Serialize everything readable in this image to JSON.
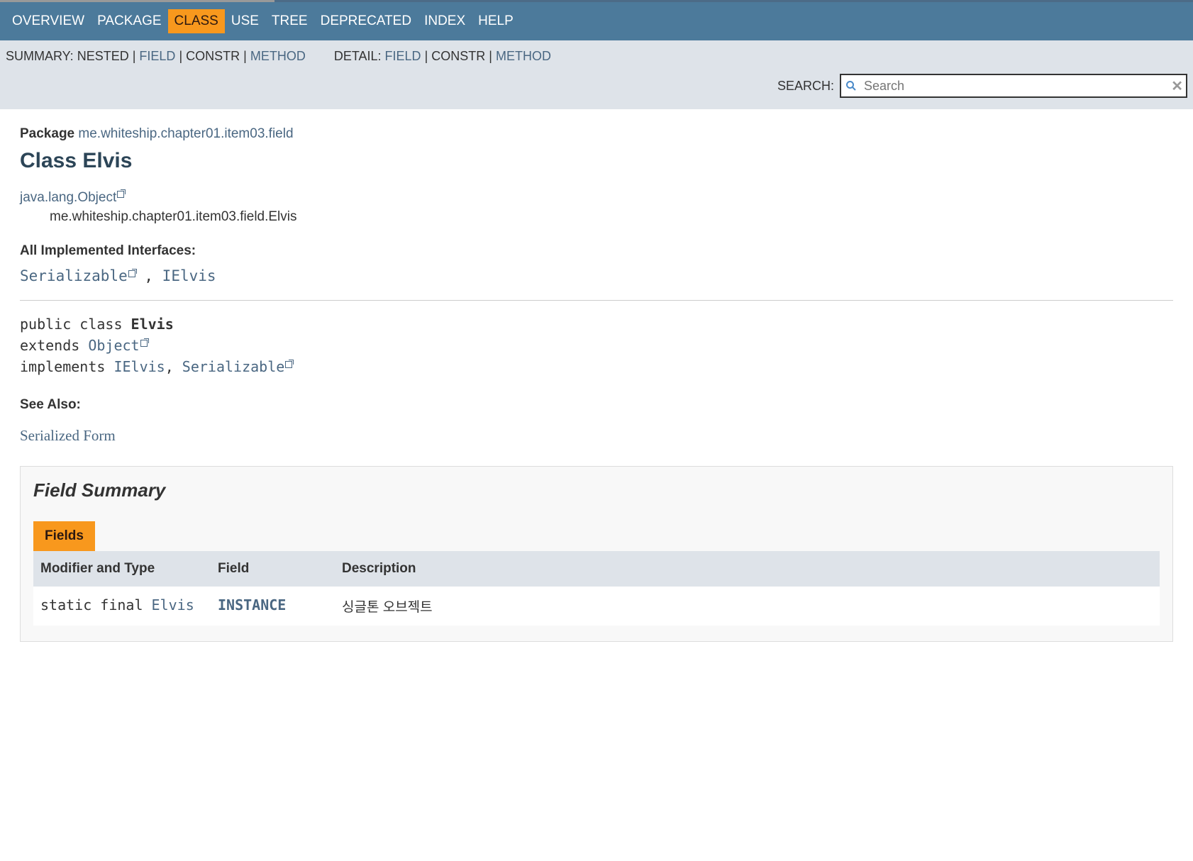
{
  "nav": {
    "items": [
      {
        "label": "OVERVIEW",
        "active": false
      },
      {
        "label": "PACKAGE",
        "active": false
      },
      {
        "label": "CLASS",
        "active": true
      },
      {
        "label": "USE",
        "active": false
      },
      {
        "label": "TREE",
        "active": false
      },
      {
        "label": "DEPRECATED",
        "active": false
      },
      {
        "label": "INDEX",
        "active": false
      },
      {
        "label": "HELP",
        "active": false
      }
    ]
  },
  "subnav": {
    "summary_label": "SUMMARY:",
    "summary_nested": "NESTED",
    "sep": " | ",
    "summary_field": "FIELD",
    "summary_constr": "CONSTR",
    "summary_method": "METHOD",
    "detail_label": "DETAIL:",
    "detail_field": "FIELD",
    "detail_constr": "CONSTR",
    "detail_method": "METHOD"
  },
  "search": {
    "label": "SEARCH:",
    "placeholder": "Search"
  },
  "pkg": {
    "prefix": "Package",
    "name": "me.whiteship.chapter01.item03.field"
  },
  "title": "Class Elvis",
  "hierarchy": {
    "parent": "java.lang.Object",
    "self": "me.whiteship.chapter01.item03.field.Elvis"
  },
  "interfaces": {
    "label": "All Implemented Interfaces:",
    "serializable": "Serializable",
    "comma": ", ",
    "ielvis": "IElvis"
  },
  "signature": {
    "line1_pre": "public class ",
    "line1_name": "Elvis",
    "line2_pre": "extends ",
    "line2_link": "Object",
    "line3_pre": "implements ",
    "line3_a": "IElvis",
    "line3_sep": ", ",
    "line3_b": "Serializable"
  },
  "see_also": {
    "label": "See Also:",
    "link": "Serialized Form"
  },
  "field_summary": {
    "title": "Field Summary",
    "tab": "Fields",
    "headers": {
      "modifier": "Modifier and Type",
      "field": "Field",
      "desc": "Description"
    },
    "rows": [
      {
        "modifier": "static final ",
        "type": "Elvis",
        "field": "INSTANCE",
        "desc": "싱글톤 오브젝트"
      }
    ]
  }
}
